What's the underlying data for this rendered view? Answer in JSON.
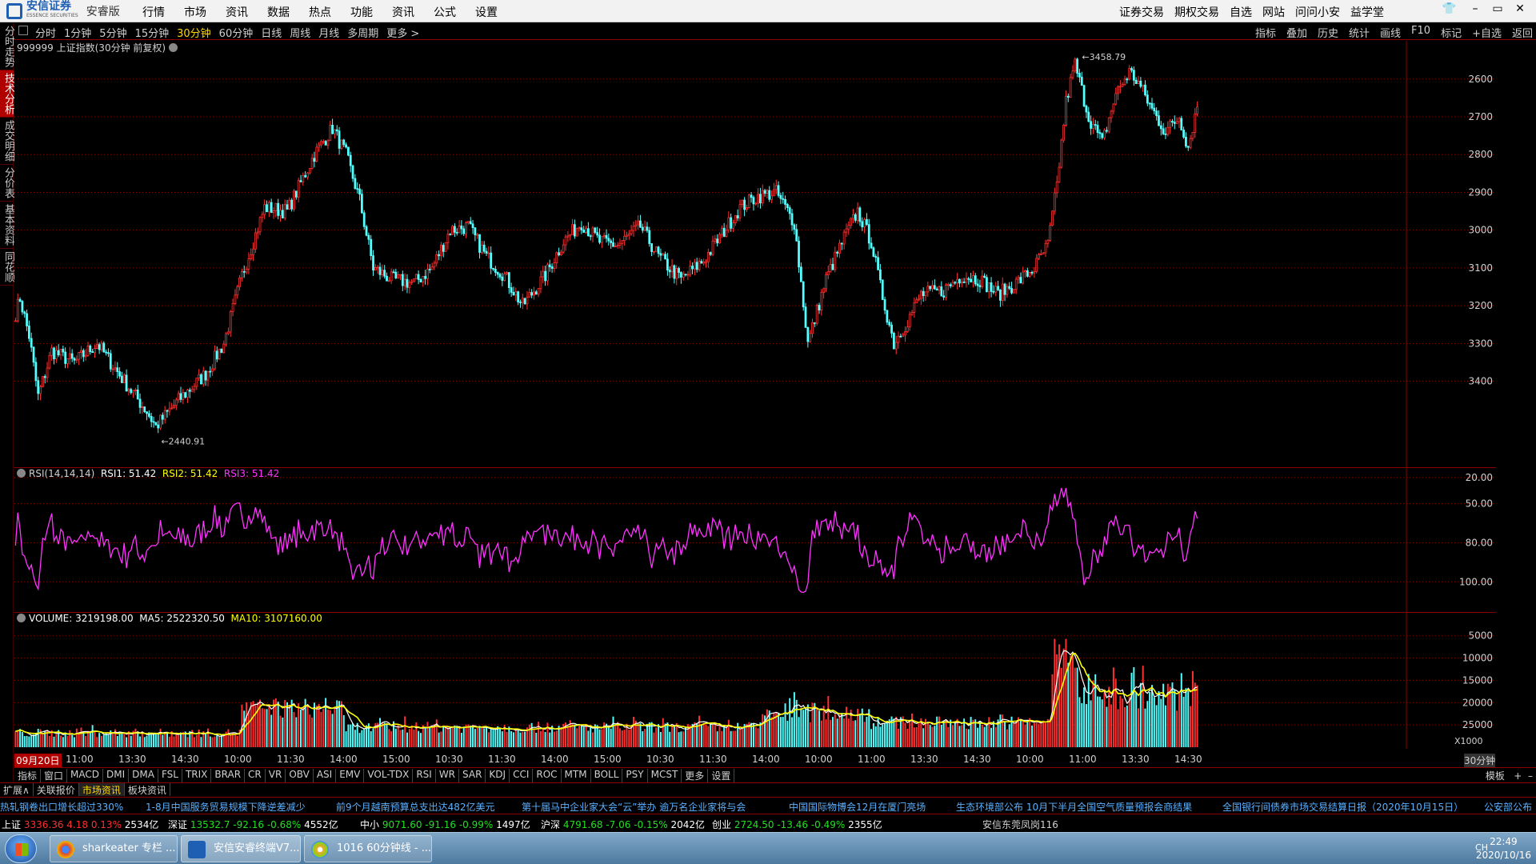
{
  "app": {
    "brand": "安信证券",
    "brand_en": "ESSENCE SECURITIES",
    "edition": "安睿版",
    "menus": [
      "行情",
      "市场",
      "资讯",
      "数据",
      "热点",
      "功能",
      "资讯",
      "公式",
      "设置"
    ],
    "top_links": [
      "证券交易",
      "期权交易",
      "自选",
      "网站",
      "问问小安",
      "益学堂"
    ],
    "window_controls": [
      "–",
      "▭",
      "✕"
    ]
  },
  "side_tabs": [
    "分时走势",
    "技术分析",
    "成交明细",
    "分价表",
    "基本资料",
    "同花顺"
  ],
  "active_side_tab": "技术分析",
  "periods": [
    "分时",
    "1分钟",
    "5分钟",
    "15分钟",
    "30分钟",
    "60分钟",
    "日线",
    "周线",
    "月线",
    "多周期",
    "更多 >"
  ],
  "active_period": "30分钟",
  "tools": [
    "指标",
    "叠加",
    "历史",
    "统计",
    "画线",
    "F10",
    "标记",
    "+自选",
    "返回"
  ],
  "main_panel": {
    "title": "999999 上证指数(30分钟 前复权)",
    "high_label": "3458.79",
    "low_label": "2440.91",
    "y_ticks": [
      "3400",
      "3300",
      "3200",
      "3100",
      "3000",
      "2900",
      "2800",
      "2700",
      "2600"
    ]
  },
  "rsi_panel": {
    "name": "RSI(14,14,14)",
    "rsi1": "RSI1: 51.42",
    "rsi2": "RSI2: 51.42",
    "rsi3": "RSI3: 51.42",
    "y_ticks": [
      "100.00",
      "80.00",
      "50.00",
      "20.00"
    ]
  },
  "volume_panel": {
    "name": "VOLUME: 3219198.00",
    "ma5": "MA5: 2522320.50",
    "ma10": "MA10: 3107160.00",
    "y_ticks": [
      "25000",
      "20000",
      "15000",
      "10000",
      "5000"
    ],
    "unit": "X1000"
  },
  "x_axis": {
    "first_label": "09月20日",
    "labels": [
      "11:00",
      "13:30",
      "14:30",
      "10:00",
      "11:30",
      "14:00",
      "15:00",
      "10:30",
      "11:30",
      "14:00",
      "15:00",
      "10:30",
      "11:30",
      "14:00",
      "10:00",
      "11:00",
      "13:30",
      "14:30",
      "10:00",
      "11:00",
      "13:30",
      "14:30"
    ],
    "period_badge": "30分钟"
  },
  "indicator_tabs": [
    "指标",
    "窗口",
    "MACD",
    "DMI",
    "DMA",
    "FSL",
    "TRIX",
    "BRAR",
    "CR",
    "VR",
    "OBV",
    "ASI",
    "EMV",
    "VOL-TDX",
    "RSI",
    "WR",
    "SAR",
    "KDJ",
    "CCI",
    "ROC",
    "MTM",
    "BOLL",
    "PSY",
    "MCST",
    "更多",
    "设置"
  ],
  "indicator_right": "模板",
  "zoom_controls": [
    "+",
    "–"
  ],
  "info_tabs": [
    "扩展∧",
    "关联报价",
    "市场资讯",
    "板块资讯"
  ],
  "active_info_tab": "市场资讯",
  "news_ticker": [
    "热轧钢卷出口增长超过330%",
    "1-8月中国服务贸易规模下降逆差减少",
    "前9个月越南预算总支出达482亿美元",
    "第十届马中企业家大会“云”举办 逾万名企业家将与会",
    "中国国际物博会12月在厦门亮场",
    "生态环境部公布  10月下半月全国空气质量预报会商结果",
    "全国银行间债券市场交易结算日报（2020年10月15日）",
    "公安部公布"
  ],
  "status_bar": {
    "indices": [
      {
        "name": "上证",
        "price": "3336.36",
        "change": "4.18",
        "pct": "0.13%",
        "amount": "2534亿",
        "dir": "up"
      },
      {
        "name": "深证",
        "price": "13532.7",
        "change": "-92.16",
        "pct": "-0.68%",
        "amount": "4552亿",
        "dir": "down"
      },
      {
        "name": "中小",
        "price": "9071.60",
        "change": "-91.16",
        "pct": "-0.99%",
        "amount": "1497亿",
        "dir": "down"
      },
      {
        "name": "沪深",
        "price": "4791.68",
        "change": "-7.06",
        "pct": "-0.15%",
        "amount": "2042亿",
        "dir": "down"
      },
      {
        "name": "创业",
        "price": "2724.50",
        "change": "-13.46",
        "pct": "-0.49%",
        "amount": "2355亿",
        "dir": "down"
      }
    ],
    "branch": "安信东莞凤岗116"
  },
  "taskbar": {
    "items": [
      "sharkeater 专栏 ...",
      "安信安睿终端V7....",
      "1016 60分钟线 - ..."
    ],
    "tray_lang": "CH",
    "time": "22:49",
    "date": "2020/10/16"
  },
  "colors": {
    "up": "#ff3030",
    "down": "#20e020",
    "candle_down": "#54ffff",
    "rsi": "#ff33ff",
    "ma5_vol": "#ffffff",
    "ma10_vol": "#ffff00",
    "grid": "#8b0000"
  },
  "chart_data": [
    {
      "type": "candlestick",
      "title": "999999 上证指数(30分钟 前复权)",
      "ylim": [
        2400,
        3480
      ],
      "y_ticks": [
        2600,
        2700,
        2800,
        2900,
        3000,
        3100,
        3200,
        3300,
        3400
      ],
      "annotations": [
        {
          "label": "3458.79",
          "type": "high"
        },
        {
          "label": "2440.91",
          "type": "low"
        }
      ],
      "close_path": [
        [
          0,
          2780
        ],
        [
          2,
          2820
        ],
        [
          6,
          2720
        ],
        [
          10,
          2560
        ],
        [
          16,
          2680
        ],
        [
          26,
          2650
        ],
        [
          36,
          2700
        ],
        [
          48,
          2600
        ],
        [
          58,
          2520
        ],
        [
          62,
          2480
        ],
        [
          72,
          2550
        ],
        [
          84,
          2620
        ],
        [
          92,
          2700
        ],
        [
          100,
          2880
        ],
        [
          110,
          3060
        ],
        [
          120,
          3050
        ],
        [
          132,
          3200
        ],
        [
          140,
          3270
        ],
        [
          146,
          3200
        ],
        [
          152,
          3080
        ],
        [
          158,
          2900
        ],
        [
          166,
          2870
        ],
        [
          176,
          2860
        ],
        [
          184,
          2900
        ],
        [
          192,
          3000
        ],
        [
          200,
          3010
        ],
        [
          208,
          2930
        ],
        [
          216,
          2880
        ],
        [
          224,
          2800
        ],
        [
          234,
          2880
        ],
        [
          242,
          2970
        ],
        [
          250,
          3020
        ],
        [
          258,
          2970
        ],
        [
          266,
          2960
        ],
        [
          276,
          3010
        ],
        [
          284,
          2930
        ],
        [
          294,
          2870
        ],
        [
          304,
          2920
        ],
        [
          312,
          2990
        ],
        [
          320,
          3060
        ],
        [
          328,
          3090
        ],
        [
          336,
          3100
        ],
        [
          344,
          3020
        ],
        [
          350,
          2700
        ],
        [
          358,
          2870
        ],
        [
          366,
          2980
        ],
        [
          372,
          3050
        ],
        [
          378,
          2970
        ],
        [
          382,
          2850
        ],
        [
          388,
          2700
        ],
        [
          394,
          2760
        ],
        [
          400,
          2830
        ],
        [
          410,
          2840
        ],
        [
          418,
          2880
        ],
        [
          426,
          2870
        ],
        [
          434,
          2830
        ],
        [
          442,
          2860
        ],
        [
          450,
          2900
        ],
        [
          456,
          2960
        ],
        [
          460,
          3120
        ],
        [
          464,
          3340
        ],
        [
          468,
          3440
        ],
        [
          474,
          3300
        ],
        [
          480,
          3230
        ],
        [
          486,
          3360
        ],
        [
          492,
          3420
        ],
        [
          496,
          3390
        ],
        [
          502,
          3320
        ],
        [
          508,
          3260
        ],
        [
          514,
          3300
        ],
        [
          518,
          3220
        ],
        [
          522,
          3330
        ]
      ]
    },
    {
      "type": "line",
      "title": "RSI(14,14,14)",
      "ylim": [
        0,
        100
      ],
      "y_ticks": [
        20,
        50,
        80,
        100
      ],
      "series": [
        {
          "name": "RSI1",
          "last": 51.42
        },
        {
          "name": "RSI2",
          "last": 51.42
        },
        {
          "name": "RSI3",
          "last": 51.42
        }
      ]
    },
    {
      "type": "bar",
      "title": "VOLUME",
      "ylim": [
        0,
        28000
      ],
      "y_ticks": [
        5000,
        10000,
        15000,
        20000,
        25000
      ],
      "unit": "X1000",
      "series": [
        {
          "name": "VOLUME",
          "last": 3219198.0
        },
        {
          "name": "MA5",
          "last": 2522320.5
        },
        {
          "name": "MA10",
          "last": 3107160.0
        }
      ],
      "segments": [
        {
          "from": 0,
          "to": 100,
          "base": 2200,
          "amp": 2000
        },
        {
          "from": 100,
          "to": 145,
          "base": 6500,
          "amp": 4500
        },
        {
          "from": 145,
          "to": 330,
          "base": 3200,
          "amp": 2500
        },
        {
          "from": 330,
          "to": 378,
          "base": 5500,
          "amp": 4500
        },
        {
          "from": 378,
          "to": 458,
          "base": 4000,
          "amp": 3000
        },
        {
          "from": 458,
          "to": 470,
          "base": 15000,
          "amp": 10000
        },
        {
          "from": 470,
          "to": 522,
          "base": 8000,
          "amp": 7000
        }
      ]
    }
  ]
}
